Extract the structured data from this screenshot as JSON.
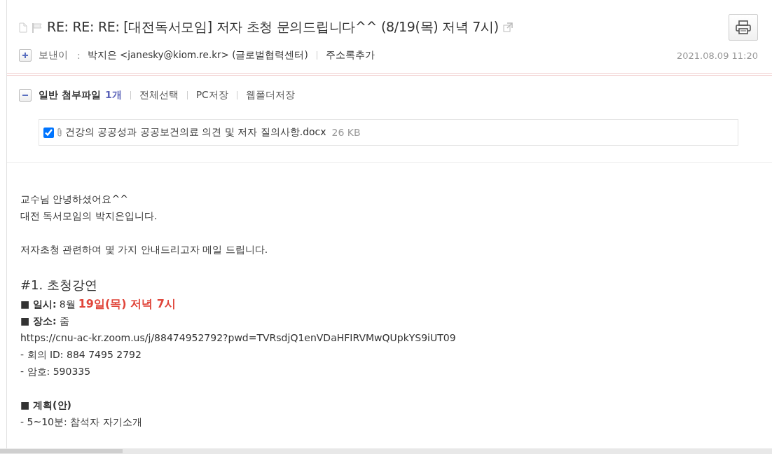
{
  "mail": {
    "subject": "RE: RE: RE: [대전독서모임] 저자 초청 문의드립니다^^ (8/19(목) 저녁 7시)",
    "sender_label": "보낸이",
    "sender_sep": ":",
    "sender": "박지은 <janesky@kiom.re.kr> (글로벌협력센터)",
    "add_contact": "주소록추가",
    "date": "2021.08.09 11:20"
  },
  "attachments": {
    "title": "일반 첨부파일",
    "count": "1개",
    "actions": [
      "전체선택",
      "PC저장",
      "웹폴더저장"
    ],
    "files": [
      {
        "name": "건강의 공공성과 공공보건의료 의견 및 저자 질의사항.docx",
        "size": "26 KB",
        "checked": true
      }
    ]
  },
  "body": [
    {
      "kind": "text",
      "text": "교수님 안녕하셨어요^^"
    },
    {
      "kind": "text",
      "text": "대전 독서모임의 박지은입니다."
    },
    {
      "kind": "blank"
    },
    {
      "kind": "text",
      "text": "저자초청 관련하여 몇 가지 안내드리고자 메일 드립니다."
    },
    {
      "kind": "blank"
    },
    {
      "kind": "heading",
      "text": "#1. 초청강연"
    },
    {
      "kind": "bullet",
      "label": "■ 일시:",
      "text": "8월",
      "highlight": "19일(목) 저녁 7시"
    },
    {
      "kind": "bullet",
      "label": "■ 장소:",
      "text": "줌"
    },
    {
      "kind": "text",
      "text": "https://cnu-ac-kr.zoom.us/j/88474952792?pwd=TVRsdjQ1enVDaHFIRVMwQUpkYS9iUT09"
    },
    {
      "kind": "text",
      "text": "- 회의 ID: 884 7495 2792"
    },
    {
      "kind": "text",
      "text": "- 암호: 590335"
    },
    {
      "kind": "blank"
    },
    {
      "kind": "bullet",
      "label": "■ 계획(안)"
    },
    {
      "kind": "text",
      "text": "- 5~10분: 참석자 자기소개"
    }
  ]
}
